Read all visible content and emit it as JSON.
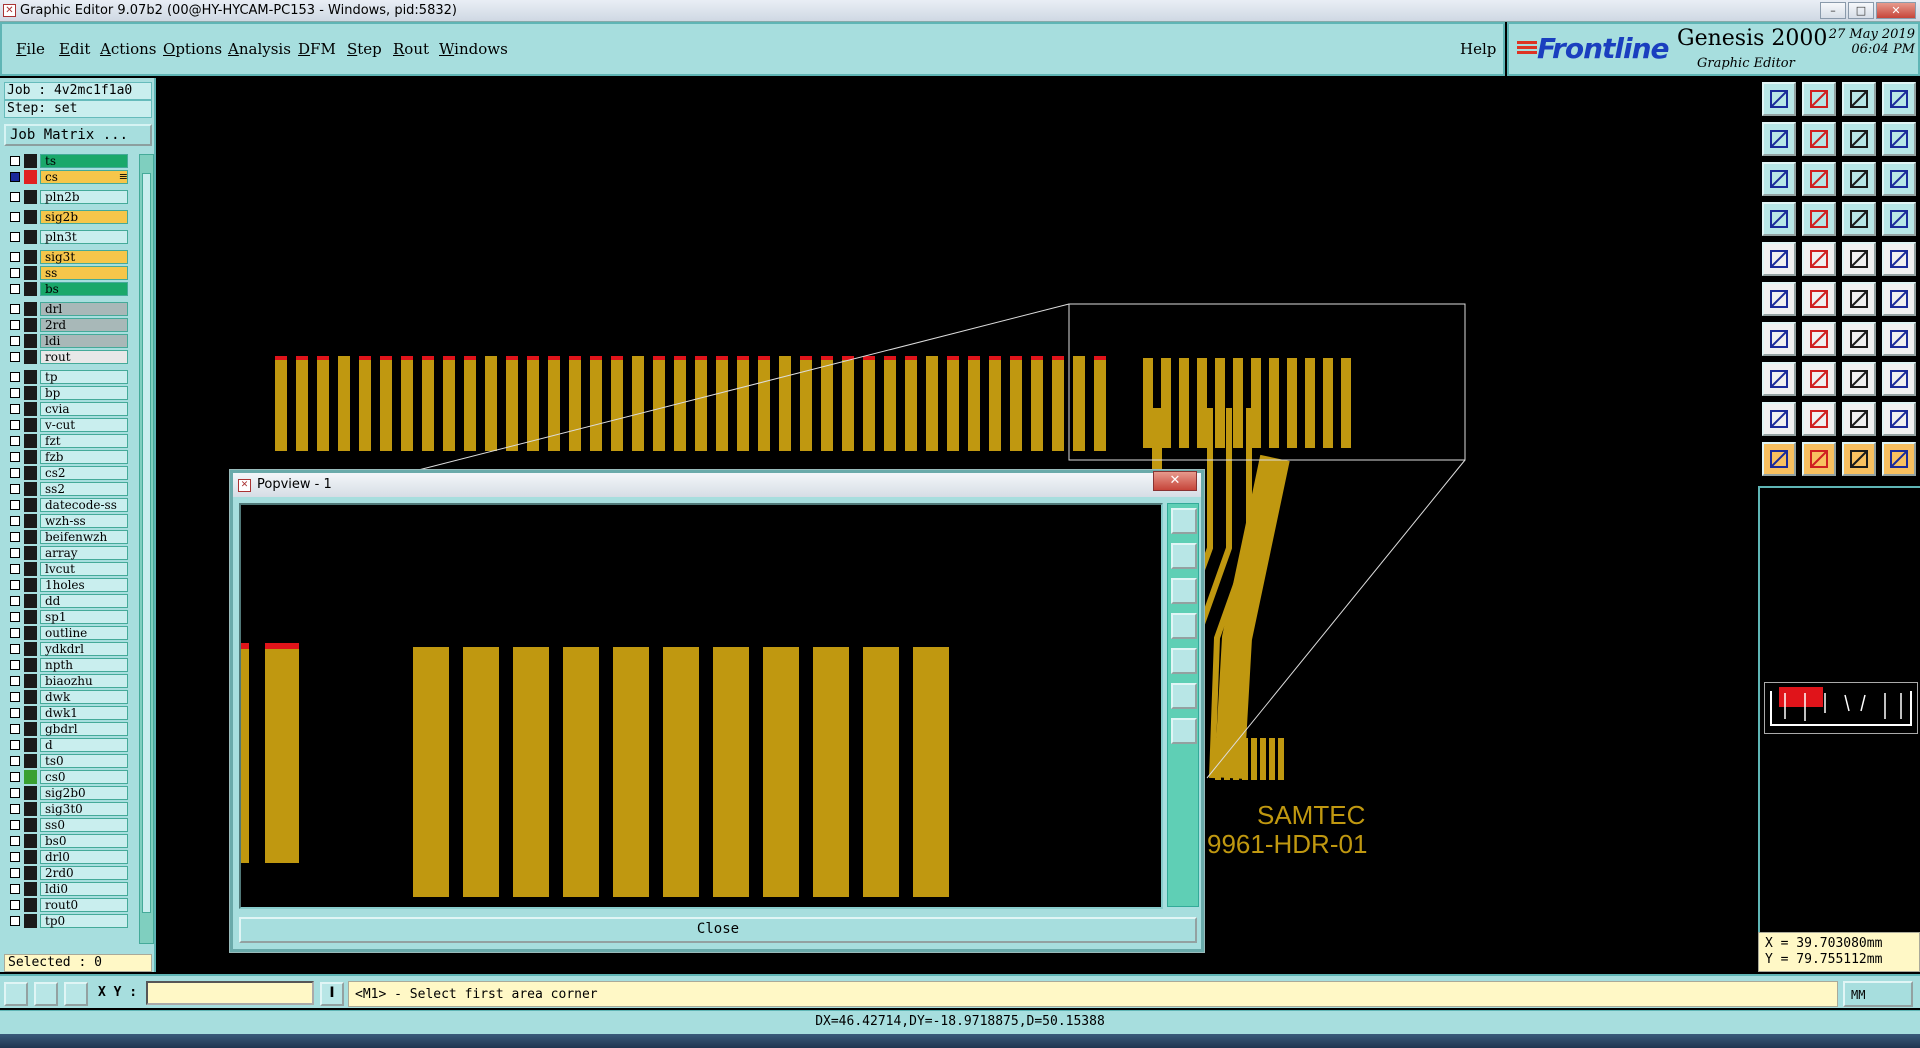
{
  "window": {
    "title": "Graphic Editor 9.07b2 (00@HY-HYCAM-PC153 - Windows, pid:5832)",
    "minimize": "–",
    "maximize": "□",
    "close": "✕"
  },
  "menu": {
    "items": [
      {
        "mnemonic": "F",
        "rest": "ile"
      },
      {
        "mnemonic": "E",
        "rest": "dit"
      },
      {
        "mnemonic": "A",
        "rest": "ctions"
      },
      {
        "mnemonic": "O",
        "rest": "ptions"
      },
      {
        "mnemonic": "A",
        "rest": "nalysis"
      },
      {
        "mnemonic": "D",
        "rest": "FM"
      },
      {
        "mnemonic": "S",
        "rest": "tep"
      },
      {
        "mnemonic": "R",
        "rest": "out"
      },
      {
        "mnemonic": "W",
        "rest": "indows"
      }
    ],
    "help": "Help"
  },
  "brand": {
    "logo": "Frontline",
    "product": "Genesis 2000",
    "subtitle": "Graphic Editor",
    "date": "27 May 2019",
    "time": "06:04 PM"
  },
  "job": {
    "job_line": "Job : 4v2mc1f1a0",
    "step_line": "Step: set",
    "matrix_button": "Job Matrix ..."
  },
  "layers": [
    {
      "name": "ts",
      "bg": "#1aa86a",
      "swatch": "#1a1a1a",
      "group": 0
    },
    {
      "name": "cs",
      "bg": "#f6c64a",
      "swatch": "#e02020",
      "group": 0,
      "active": true,
      "marker": "≡"
    },
    {
      "name": "pln2b",
      "bg": "#c9eeee",
      "swatch": "#1a1a1a",
      "group": 1
    },
    {
      "name": "sig2b",
      "bg": "#f6c64a",
      "swatch": "#1a1a1a",
      "group": 2
    },
    {
      "name": "pln3t",
      "bg": "#c9eeee",
      "swatch": "#1a1a1a",
      "group": 3
    },
    {
      "name": "sig3t",
      "bg": "#f6c64a",
      "swatch": "#1a1a1a",
      "group": 4
    },
    {
      "name": "ss",
      "bg": "#f6c64a",
      "swatch": "#1a1a1a",
      "group": 4
    },
    {
      "name": "bs",
      "bg": "#1aa86a",
      "swatch": "#1a1a1a",
      "group": 4
    },
    {
      "name": "drl",
      "bg": "#a8b8b8",
      "swatch": "#1a1a1a",
      "group": 5
    },
    {
      "name": "2rd",
      "bg": "#a8b8b8",
      "swatch": "#1a1a1a",
      "group": 5
    },
    {
      "name": "ldi",
      "bg": "#a8b8b8",
      "swatch": "#1a1a1a",
      "group": 5
    },
    {
      "name": "rout",
      "bg": "#e8e8e8",
      "swatch": "#1a1a1a",
      "group": 5
    },
    {
      "name": "tp",
      "bg": "#c9eeee",
      "swatch": "#1a1a1a",
      "group": 6
    },
    {
      "name": "bp",
      "bg": "#c9eeee",
      "swatch": "#1a1a1a",
      "group": 6
    },
    {
      "name": "cvia",
      "bg": "#c9eeee",
      "swatch": "#1a1a1a",
      "group": 6
    },
    {
      "name": "v-cut",
      "bg": "#c9eeee",
      "swatch": "#1a1a1a",
      "group": 6
    },
    {
      "name": "fzt",
      "bg": "#c9eeee",
      "swatch": "#1a1a1a",
      "group": 6
    },
    {
      "name": "fzb",
      "bg": "#c9eeee",
      "swatch": "#1a1a1a",
      "group": 6
    },
    {
      "name": "cs2",
      "bg": "#c9eeee",
      "swatch": "#1a1a1a",
      "group": 6
    },
    {
      "name": "ss2",
      "bg": "#c9eeee",
      "swatch": "#1a1a1a",
      "group": 6
    },
    {
      "name": "datecode-ss",
      "bg": "#c9eeee",
      "swatch": "#1a1a1a",
      "group": 6
    },
    {
      "name": "wzh-ss",
      "bg": "#c9eeee",
      "swatch": "#1a1a1a",
      "group": 6
    },
    {
      "name": "beifenwzh",
      "bg": "#c9eeee",
      "swatch": "#1a1a1a",
      "group": 6
    },
    {
      "name": "array",
      "bg": "#c9eeee",
      "swatch": "#1a1a1a",
      "group": 6
    },
    {
      "name": "lvcut",
      "bg": "#c9eeee",
      "swatch": "#1a1a1a",
      "group": 6
    },
    {
      "name": "1holes",
      "bg": "#c9eeee",
      "swatch": "#1a1a1a",
      "group": 6
    },
    {
      "name": "dd",
      "bg": "#c9eeee",
      "swatch": "#1a1a1a",
      "group": 6
    },
    {
      "name": "sp1",
      "bg": "#c9eeee",
      "swatch": "#1a1a1a",
      "group": 6
    },
    {
      "name": "outline",
      "bg": "#c9eeee",
      "swatch": "#1a1a1a",
      "group": 6
    },
    {
      "name": "ydkdrl",
      "bg": "#c9eeee",
      "swatch": "#1a1a1a",
      "group": 6
    },
    {
      "name": "npth",
      "bg": "#c9eeee",
      "swatch": "#1a1a1a",
      "group": 6
    },
    {
      "name": "biaozhu",
      "bg": "#c9eeee",
      "swatch": "#1a1a1a",
      "group": 6
    },
    {
      "name": "dwk",
      "bg": "#c9eeee",
      "swatch": "#1a1a1a",
      "group": 6
    },
    {
      "name": "dwk1",
      "bg": "#c9eeee",
      "swatch": "#1a1a1a",
      "group": 6
    },
    {
      "name": "gbdrl",
      "bg": "#c9eeee",
      "swatch": "#1a1a1a",
      "group": 6
    },
    {
      "name": "d",
      "bg": "#c9eeee",
      "swatch": "#1a1a1a",
      "group": 6
    },
    {
      "name": "ts0",
      "bg": "#c9eeee",
      "swatch": "#1a1a1a",
      "group": 6
    },
    {
      "name": "cs0",
      "bg": "#c9eeee",
      "swatch": "#3aa030",
      "group": 6
    },
    {
      "name": "sig2b0",
      "bg": "#c9eeee",
      "swatch": "#1a1a1a",
      "group": 6
    },
    {
      "name": "sig3t0",
      "bg": "#c9eeee",
      "swatch": "#1a1a1a",
      "group": 6
    },
    {
      "name": "ss0",
      "bg": "#c9eeee",
      "swatch": "#1a1a1a",
      "group": 6
    },
    {
      "name": "bs0",
      "bg": "#c9eeee",
      "swatch": "#1a1a1a",
      "group": 6
    },
    {
      "name": "drl0",
      "bg": "#c9eeee",
      "swatch": "#1a1a1a",
      "group": 6
    },
    {
      "name": "2rd0",
      "bg": "#c9eeee",
      "swatch": "#1a1a1a",
      "group": 6
    },
    {
      "name": "ldi0",
      "bg": "#c9eeee",
      "swatch": "#1a1a1a",
      "group": 6
    },
    {
      "name": "rout0",
      "bg": "#c9eeee",
      "swatch": "#1a1a1a",
      "group": 6
    },
    {
      "name": "tp0",
      "bg": "#c9eeee",
      "swatch": "#1a1a1a",
      "group": 6
    }
  ],
  "selected": "Selected : 0",
  "canvas": {
    "label1": "SAMTEC",
    "label2": "9961-HDR-01",
    "trace_color": "#c09810",
    "pad_tip_color": "#e0141a"
  },
  "popview": {
    "title": "Popview - 1",
    "close_label": "Close",
    "close_x": "✕"
  },
  "coords": {
    "x": "X = 39.703080mm",
    "y": "Y = 79.755112mm"
  },
  "command": {
    "xy_label": "X Y :",
    "xy_value": "",
    "cursor_label": "I",
    "prompt": "<M1> - Select first area corner",
    "units": "MM"
  },
  "status": "DX=46.42714,DY=-18.9718875,D=50.15388"
}
